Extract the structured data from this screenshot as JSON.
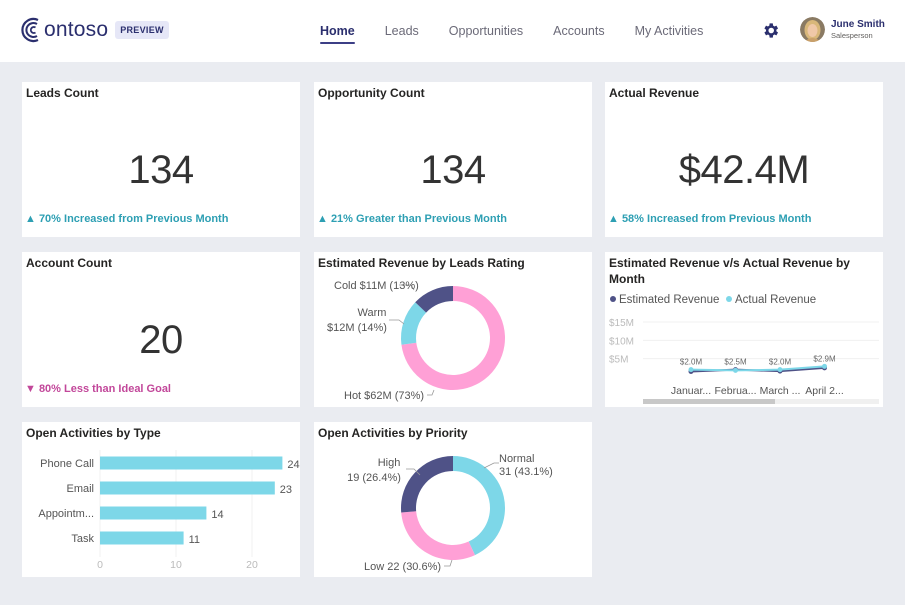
{
  "header": {
    "logo_text": "ontoso",
    "preview_badge": "PREVIEW",
    "nav": [
      {
        "label": "Home",
        "active": true
      },
      {
        "label": "Leads",
        "active": false
      },
      {
        "label": "Opportunities",
        "active": false
      },
      {
        "label": "Accounts",
        "active": false
      },
      {
        "label": "My Activities",
        "active": false
      }
    ],
    "settings_icon": "gear-icon",
    "user": {
      "name": "June Smith",
      "role": "Salesperson"
    }
  },
  "colors": {
    "brand": "#2b2f6e",
    "up": "#2d9fb3",
    "down": "#c2479a",
    "navy": "#4f5287",
    "cyan": "#7dd7e8",
    "pink": "#ffa0d6"
  },
  "kpis": {
    "leads": {
      "title": "Leads Count",
      "value": "134",
      "note": "▲ 70% Increased from Previous Month",
      "trend": "up"
    },
    "opportunities": {
      "title": "Opportunity Count",
      "value": "134",
      "note": "▲ 21% Greater than Previous Month",
      "trend": "up"
    },
    "revenue": {
      "title": "Actual Revenue",
      "value": "$42.4M",
      "note": "▲ 58% Increased from Previous Month",
      "trend": "up"
    },
    "accounts": {
      "title": "Account Count",
      "value": "20",
      "note": "▼ 80% Less than Ideal Goal",
      "trend": "down"
    }
  },
  "chart_data": [
    {
      "id": "leads_rating",
      "type": "pie",
      "title": "Estimated Revenue by Leads Rating",
      "donut": true,
      "slices": [
        {
          "label": "Hot",
          "value": 62,
          "display": "$62M",
          "percent": 73,
          "color": "#ffa0d6",
          "label_text": "Hot $62M (73%)"
        },
        {
          "label": "Warm",
          "value": 12,
          "display": "$12M",
          "percent": 14,
          "color": "#7dd7e8",
          "label_text_1": "Warm",
          "label_text_2": "$12M (14%)"
        },
        {
          "label": "Cold",
          "value": 11,
          "display": "$11M",
          "percent": 13,
          "color": "#4f5287",
          "label_text": "Cold $11M (13%)"
        }
      ]
    },
    {
      "id": "revenue_by_month",
      "type": "line",
      "title": "Estimated Revenue v/s Actual Revenue by Month",
      "legend": [
        "Estimated Revenue",
        "Actual Revenue"
      ],
      "legend_position": "top-left",
      "categories": [
        "Januar...",
        "Februa...",
        "March ...",
        "April 2..."
      ],
      "yticks": [
        "$5M",
        "$10M",
        "$15M"
      ],
      "ylim": [
        0,
        15
      ],
      "series": [
        {
          "name": "Estimated Revenue",
          "color": "#4f5287",
          "values": [
            1.5,
            2.0,
            1.6,
            2.5
          ]
        },
        {
          "name": "Actual Revenue",
          "color": "#7dd7e8",
          "values": [
            2.0,
            1.8,
            2.0,
            2.9
          ]
        }
      ],
      "data_labels": [
        "$2.0M",
        "$2.5M",
        "$2.0M",
        "$2.9M"
      ],
      "grid": true
    },
    {
      "id": "activities_by_type",
      "type": "bar",
      "orientation": "horizontal",
      "title": "Open Activities by Type",
      "categories": [
        "Phone Call",
        "Email",
        "Appointm...",
        "Task"
      ],
      "values": [
        24,
        23,
        14,
        11
      ],
      "xticks": [
        "0",
        "10",
        "20"
      ],
      "xlim": [
        0,
        25
      ],
      "color": "#7dd7e8"
    },
    {
      "id": "activities_by_priority",
      "type": "pie",
      "title": "Open Activities by Priority",
      "donut": true,
      "slices": [
        {
          "label": "Normal",
          "value": 31,
          "percent": 43.1,
          "color": "#7dd7e8",
          "label_text_1": "Normal",
          "label_text_2": "31 (43.1%)"
        },
        {
          "label": "Low",
          "value": 22,
          "percent": 30.6,
          "color": "#ffa0d6",
          "label_text": "Low 22 (30.6%)"
        },
        {
          "label": "High",
          "value": 19,
          "percent": 26.4,
          "color": "#4f5287",
          "label_text_1": "High",
          "label_text_2": "19 (26.4%)"
        }
      ]
    }
  ]
}
